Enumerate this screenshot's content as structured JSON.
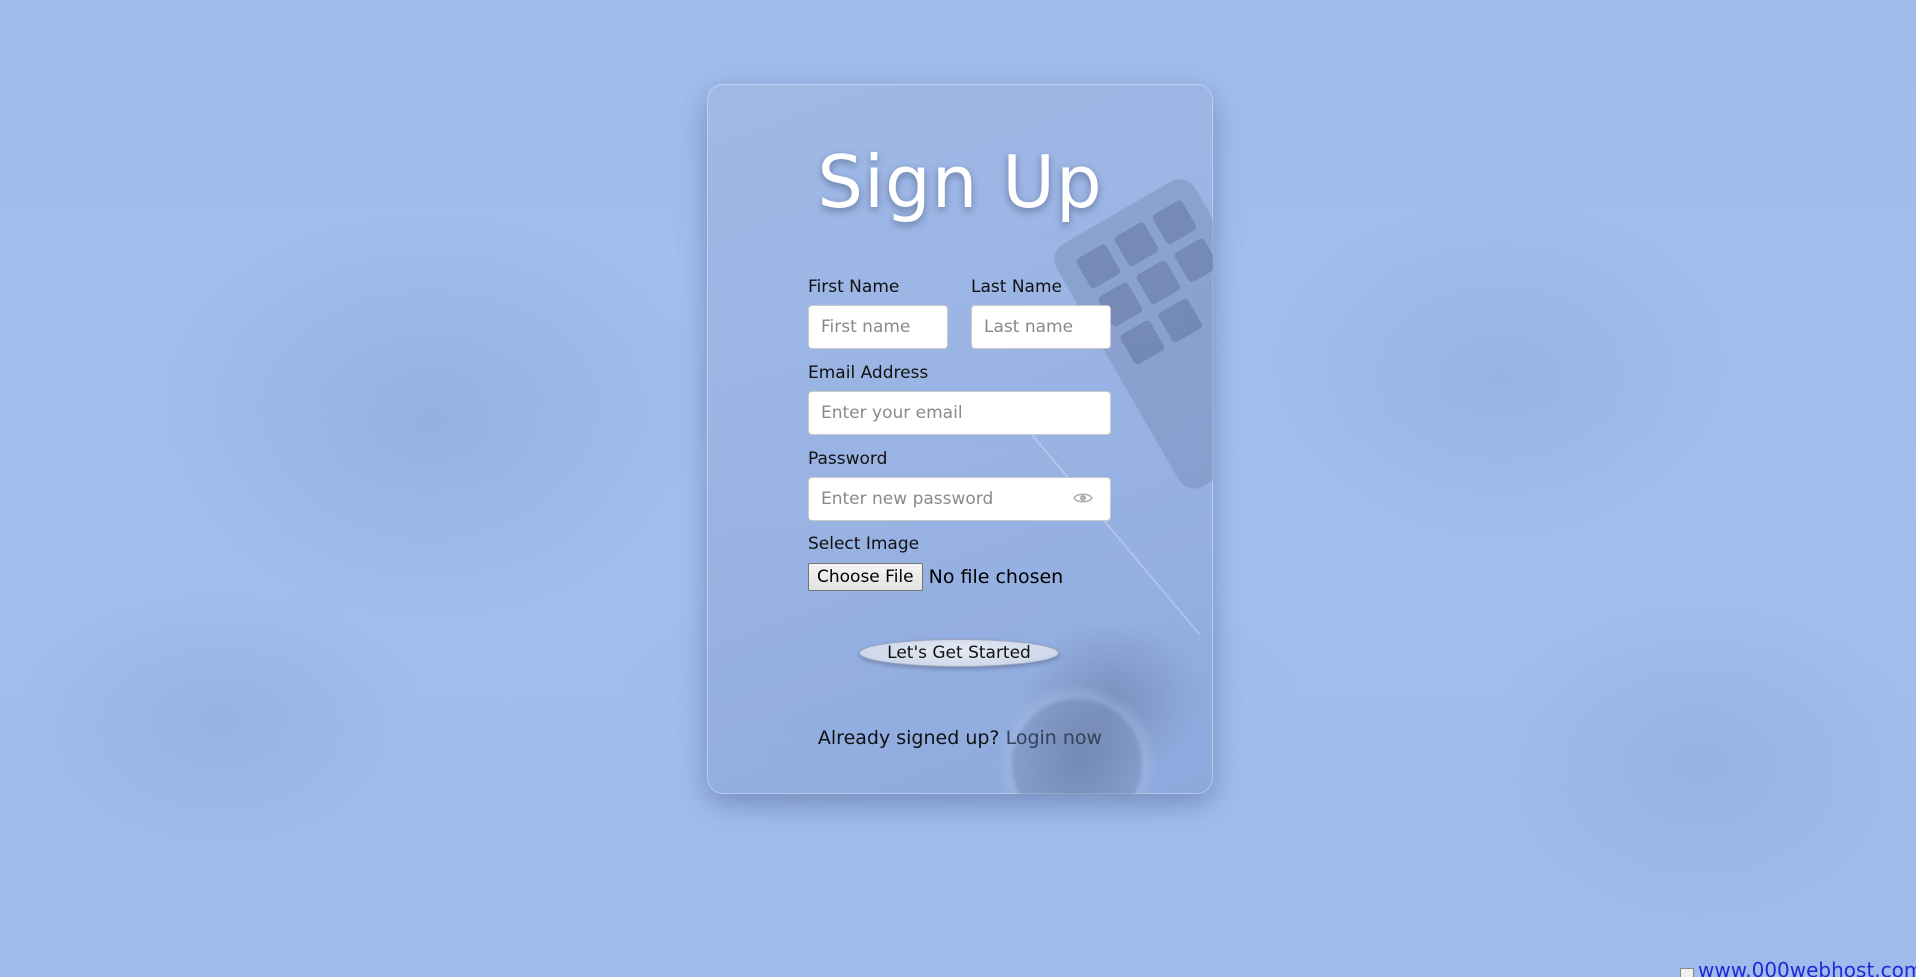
{
  "page": {
    "title": "Sign Up",
    "background_color": "#a2bfed"
  },
  "form": {
    "first_name": {
      "label": "First Name",
      "placeholder": "First name"
    },
    "last_name": {
      "label": "Last Name",
      "placeholder": "Last name"
    },
    "email": {
      "label": "Email Address",
      "placeholder": "Enter your email"
    },
    "password": {
      "label": "Password",
      "placeholder": "Enter new password",
      "toggle_icon": "eye-icon"
    },
    "image": {
      "label": "Select Image",
      "button_label": "Choose File",
      "status": "No file chosen"
    },
    "submit_label": "Let's Get Started"
  },
  "footer": {
    "prompt": "Already signed up?",
    "link_label": "Login now"
  },
  "host_badge": {
    "text": "www.000webhost.com"
  }
}
